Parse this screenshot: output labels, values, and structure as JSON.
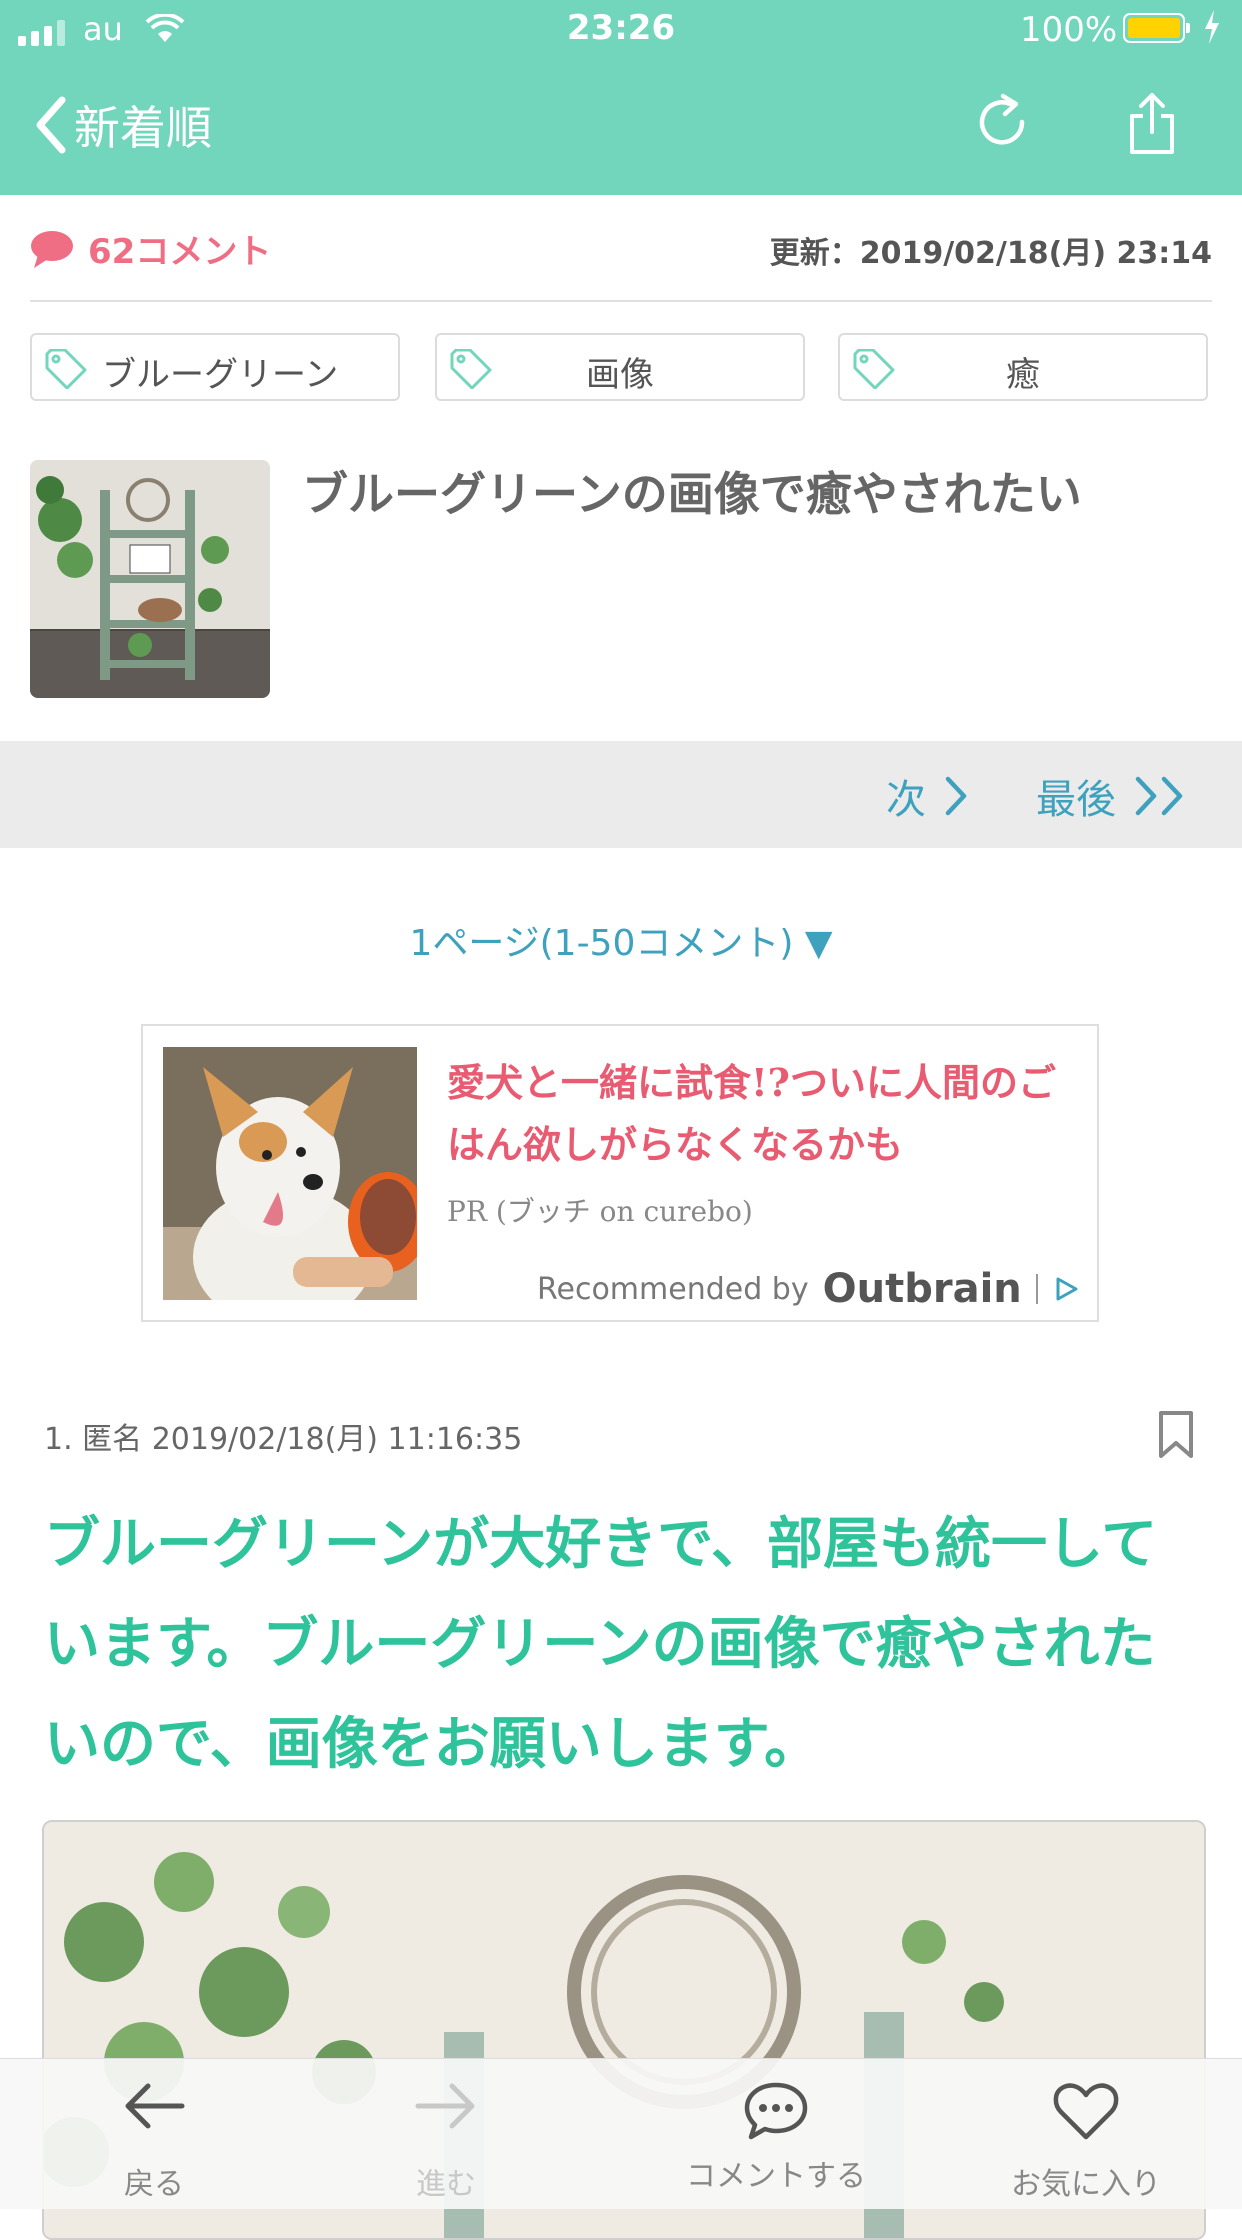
{
  "status_bar": {
    "carrier": "au",
    "time": "23:26",
    "battery": "100%"
  },
  "nav": {
    "back_label": "新着順"
  },
  "meta": {
    "comments": "62コメント",
    "updated": "更新：2019/02/18(月) 23:14"
  },
  "tags": [
    "ブルーグリーン",
    "画像",
    "癒"
  ],
  "article": {
    "title": "ブルーグリーンの画像で癒やされたい"
  },
  "pager": {
    "next": "次",
    "last": "最後"
  },
  "page_select": "1ページ(1-50コメント) ▼",
  "ad": {
    "headline": "愛犬と一緒に試食!?ついに人間のごはん欲しがらなくなるかも",
    "source": "PR (ブッチ on curebo)",
    "recommended": "Recommended by",
    "brand": "Outbrain"
  },
  "comment": {
    "header": "1. 匿名 2019/02/18(月) 11:16:35",
    "body": "ブルーグリーンが大好きで、部屋も統一しています。ブルーグリーンの画像で癒やされたいので、画像をお願いします。"
  },
  "tabbar": {
    "back": "戻る",
    "forward": "進む",
    "comment": "コメントする",
    "favorite": "お気に入り"
  },
  "colors": {
    "header": "#72d6bd",
    "accent_pink": "#f06e84",
    "link_blue": "#3ea1be",
    "comment_green": "#2ec39b"
  }
}
